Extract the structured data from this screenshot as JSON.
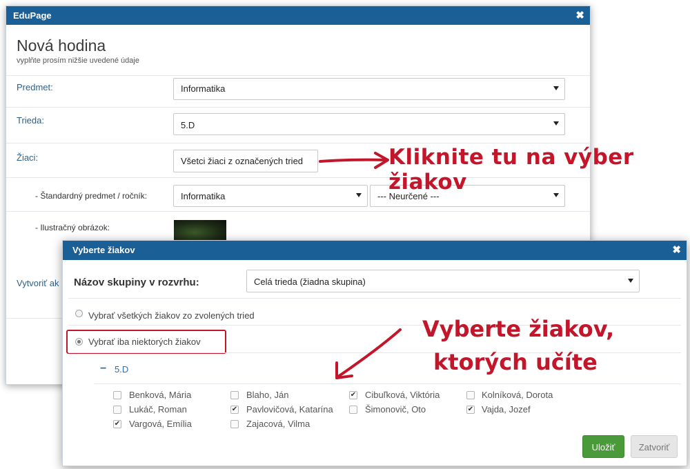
{
  "main_dialog": {
    "title": "EduPage",
    "close_glyph": "✖",
    "heading": "Nová hodina",
    "subheading": "vyplňte prosím nižšie uvedené údaje",
    "fields": {
      "subject": {
        "label": "Predmet:",
        "value": "Informatika"
      },
      "class": {
        "label": "Trieda:",
        "value": "5.D"
      },
      "students": {
        "label": "Žiaci:",
        "value": "Všetci žiaci z označených tried"
      },
      "standard_subject": {
        "label": "- Štandardný predmet / ročník:",
        "value": "Informatika",
        "grade_value": "--- Neurčené ---"
      },
      "illustration": {
        "label": "- Ilustračný obrázok:"
      },
      "create": {
        "label": "Vytvoriť ak"
      }
    }
  },
  "select_dialog": {
    "title": "Vyberte žiakov",
    "close_glyph": "✖",
    "group_label": "Názov skupiny v rozvrhu:",
    "group_value": "Celá trieda (žiadna skupina)",
    "option_all": "Vybrať všetkých žiakov zo zvolených tried",
    "option_some": "Vybrať iba niektorých žiakov",
    "selected_option": "some",
    "class_collapse_glyph": "−",
    "class_name": "5.D",
    "students": [
      {
        "name": "Benková, Mária",
        "checked": false
      },
      {
        "name": "Blaho, Ján",
        "checked": false
      },
      {
        "name": "Cibuľková, Viktória",
        "checked": true
      },
      {
        "name": "Kolníková, Dorota",
        "checked": false
      },
      {
        "name": "Lukáč, Roman",
        "checked": false
      },
      {
        "name": "Pavlovičová, Katarína",
        "checked": true
      },
      {
        "name": "Šimonovič, Oto",
        "checked": false
      },
      {
        "name": "Vajda, Jozef",
        "checked": true
      },
      {
        "name": "Vargová, Emília",
        "checked": true
      },
      {
        "name": "Zajacová, Vilma",
        "checked": false
      }
    ],
    "save_label": "Uložiť",
    "close_label": "Zatvoriť"
  },
  "annotations": {
    "click_here": "Kliknite tu na výber žiakov",
    "select_line1": "Vyberte žiakov,",
    "select_line2": "ktorých učíte"
  },
  "colors": {
    "titlebar": "#1a5f96",
    "annotation": "#c4162b",
    "save_button": "#4a9a3a"
  }
}
